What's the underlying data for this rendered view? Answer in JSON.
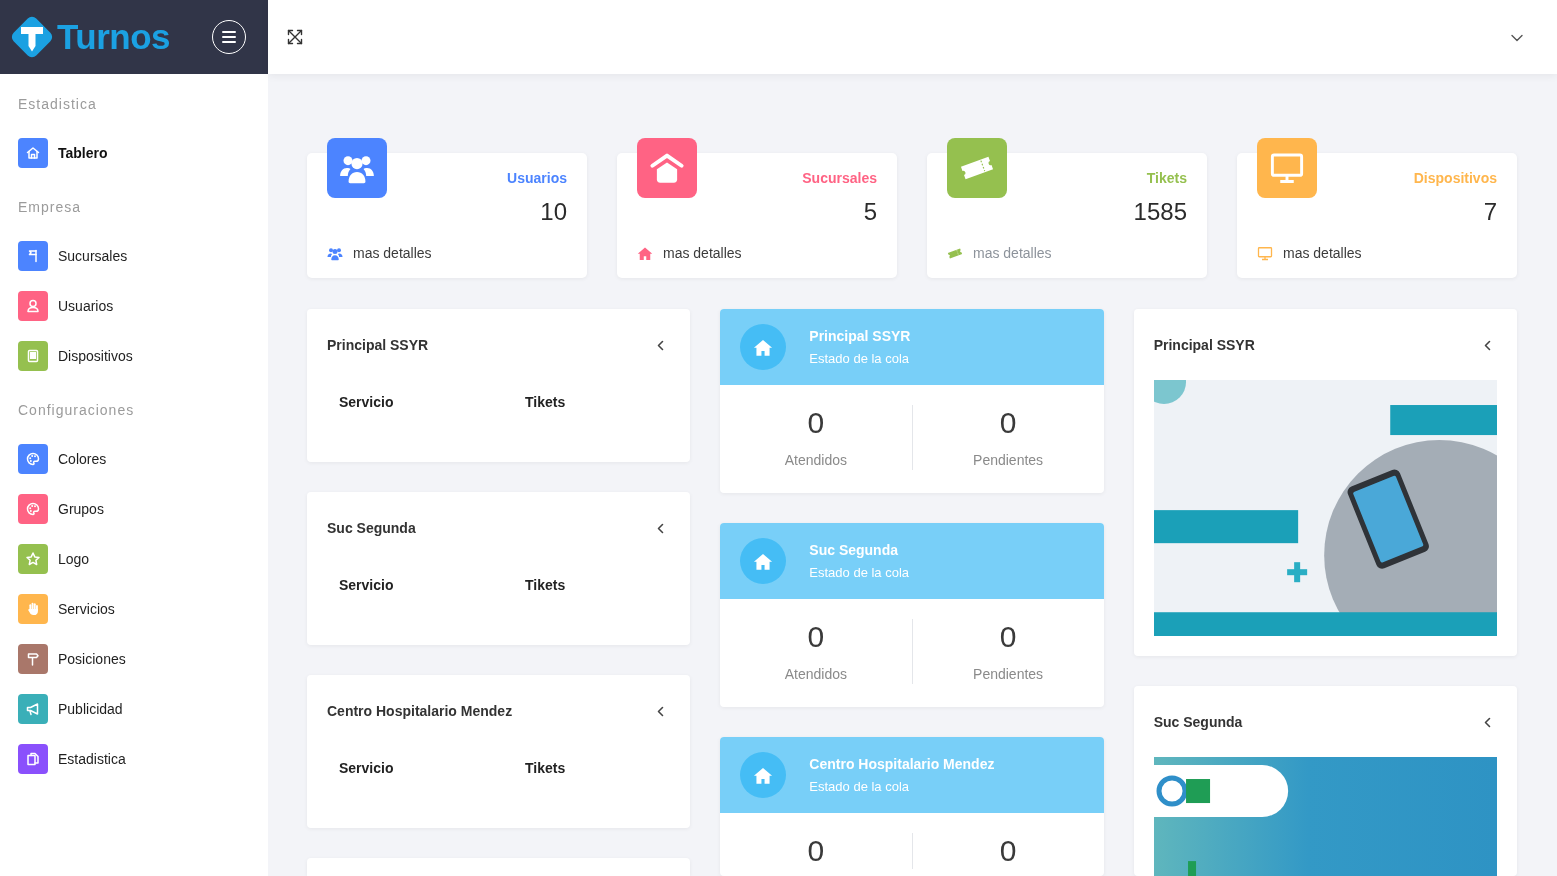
{
  "sidebar": {
    "logo_text": "Turnos",
    "sections": [
      {
        "heading": "Estadistica",
        "items": [
          {
            "label": "Tablero",
            "color": "#4c84ff",
            "selected": true
          }
        ]
      },
      {
        "heading": "Empresa",
        "items": [
          {
            "label": "Sucursales",
            "color": "#4c84ff",
            "selected": false
          },
          {
            "label": "Usuarios",
            "color": "#ff6384",
            "selected": false
          },
          {
            "label": "Dispositivos",
            "color": "#95c04f",
            "selected": false
          }
        ]
      },
      {
        "heading": "Configuraciones",
        "items": [
          {
            "label": "Colores",
            "color": "#4c84ff",
            "selected": false
          },
          {
            "label": "Grupos",
            "color": "#ff6384",
            "selected": false
          },
          {
            "label": "Logo",
            "color": "#95c04f",
            "selected": false
          },
          {
            "label": "Servicios",
            "color": "#ffb64d",
            "selected": false
          },
          {
            "label": "Posiciones",
            "color": "#a9776a",
            "selected": false
          },
          {
            "label": "Publicidad",
            "color": "#3aafb8",
            "selected": false
          },
          {
            "label": "Estadistica",
            "color": "#8a50fc",
            "selected": false
          }
        ]
      }
    ]
  },
  "stats": [
    {
      "label": "Usuarios",
      "value": "10",
      "color": "#4c84ff",
      "link": "mas detalles",
      "muted": false
    },
    {
      "label": "Sucursales",
      "value": "5",
      "color": "#ff6384",
      "link": "mas detalles",
      "muted": false
    },
    {
      "label": "Tikets",
      "value": "1585",
      "color": "#95c04f",
      "link": "mas detalles",
      "muted": true
    },
    {
      "label": "Dispositivos",
      "value": "7",
      "color": "#ffb64d",
      "link": "mas detalles",
      "muted": false
    }
  ],
  "service_tables": [
    {
      "kind": "table",
      "title": "Principal SSYR",
      "columns": [
        "Servicio",
        "Tikets"
      ]
    },
    {
      "kind": "table",
      "title": "Suc Segunda",
      "columns": [
        "Servicio",
        "Tikets"
      ]
    },
    {
      "kind": "table",
      "title": "Centro Hospitalario Mendez",
      "columns": [
        "Servicio",
        "Tikets"
      ]
    },
    {
      "kind": "cut_off"
    }
  ],
  "queues": [
    {
      "title": "Principal SSYR",
      "subtitle": "Estado de la cola",
      "stats": [
        {
          "value": "0",
          "label": "Atendidos"
        },
        {
          "value": "0",
          "label": "Pendientes"
        }
      ]
    },
    {
      "title": "Suc Segunda",
      "subtitle": "Estado de la cola",
      "stats": [
        {
          "value": "0",
          "label": "Atendidos"
        },
        {
          "value": "0",
          "label": "Pendientes"
        }
      ]
    },
    {
      "title": "Centro Hospitalario Mendez",
      "subtitle": "Estado de la cola",
      "stats": [
        {
          "value": "0"
        },
        {
          "value": "0"
        }
      ]
    }
  ],
  "ads": [
    {
      "title": "Principal SSYR"
    },
    {
      "title": "Suc Segunda"
    }
  ]
}
